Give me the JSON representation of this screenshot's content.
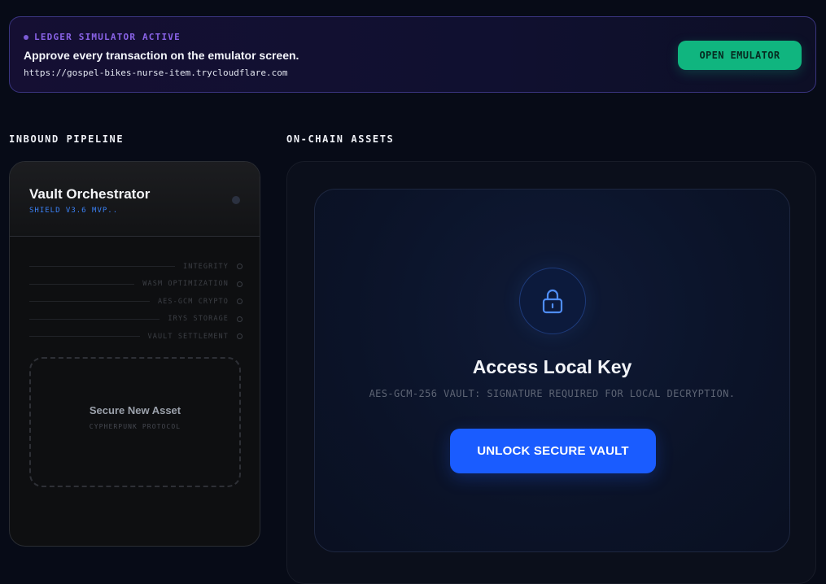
{
  "banner": {
    "status": "LEDGER SIMULATOR ACTIVE",
    "title": "Approve every transaction on the emulator screen.",
    "url": "https://gospel-bikes-nurse-item.trycloudflare.com",
    "button": "OPEN EMULATOR"
  },
  "sections": {
    "pipeline": "INBOUND PIPELINE",
    "assets": "ON-CHAIN ASSETS"
  },
  "orchestrator": {
    "name": "Vault Orchestrator",
    "version": "SHIELD V3.6 MVP..",
    "stages": [
      "INTEGRITY",
      "WASM OPTIMIZATION",
      "AES-GCM CRYPTO",
      "IRYS STORAGE",
      "VAULT SETTLEMENT"
    ],
    "new_asset_title": "Secure New Asset",
    "new_asset_subtitle": "CYPHERPUNK PROTOCOL"
  },
  "vault": {
    "icon": "lock-icon",
    "title": "Access Local Key",
    "subtitle": "AES-GCM-256 VAULT: SIGNATURE REQUIRED FOR LOCAL DECRYPTION.",
    "button": "UNLOCK SECURE VAULT"
  },
  "colors": {
    "accent": "#1a5cff",
    "success": "#10b57f",
    "status": "#8a63e8",
    "background": "#070b17"
  }
}
